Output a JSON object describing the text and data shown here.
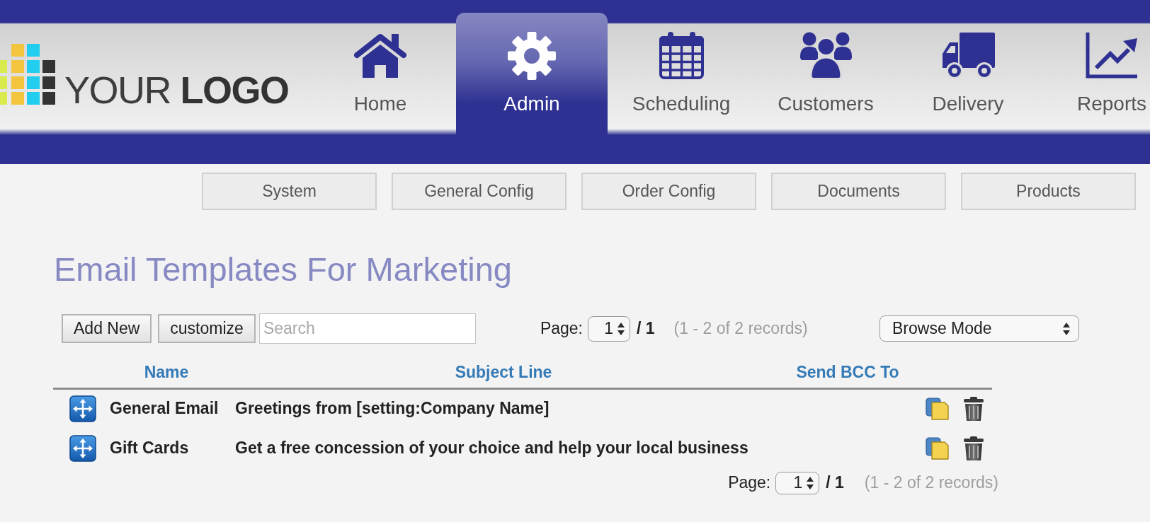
{
  "logo": {
    "text": "YOUR **LOGO**"
  },
  "nav": [
    {
      "label": "Home",
      "selected": false
    },
    {
      "label": "Admin",
      "selected": true
    },
    {
      "label": "Scheduling",
      "selected": false
    },
    {
      "label": "Customers",
      "selected": false
    },
    {
      "label": "Delivery",
      "selected": false
    },
    {
      "label": "Reports",
      "selected": false
    }
  ],
  "subnav": [
    "System",
    "General Config",
    "Order Config",
    "Documents",
    "Products"
  ],
  "page_title": "Email Templates For Marketing",
  "toolbar": {
    "buttons": [
      "Add New",
      "customize"
    ],
    "search": {
      "placeholder": "Search"
    },
    "pager": {
      "label": "Page:",
      "page": "1",
      "total": "/ 1",
      "records": "(1 - 2 of 2 records)"
    },
    "mode_select": {
      "value": "Browse Mode"
    }
  },
  "table": {
    "columns": [
      "Name",
      "Subject Line",
      "Send BCC To"
    ],
    "rows": [
      {
        "name": "General Email",
        "subject_line": "Greetings from [setting:Company Name]"
      },
      {
        "name": "Gift Cards",
        "subject_line": "Get a free concession of your choice and help your local business"
      }
    ]
  },
  "bottom_pager": {
    "label": "Page:",
    "page": "1",
    "total": "/ 1",
    "records": "(1 - 2 of 2 records)"
  }
}
